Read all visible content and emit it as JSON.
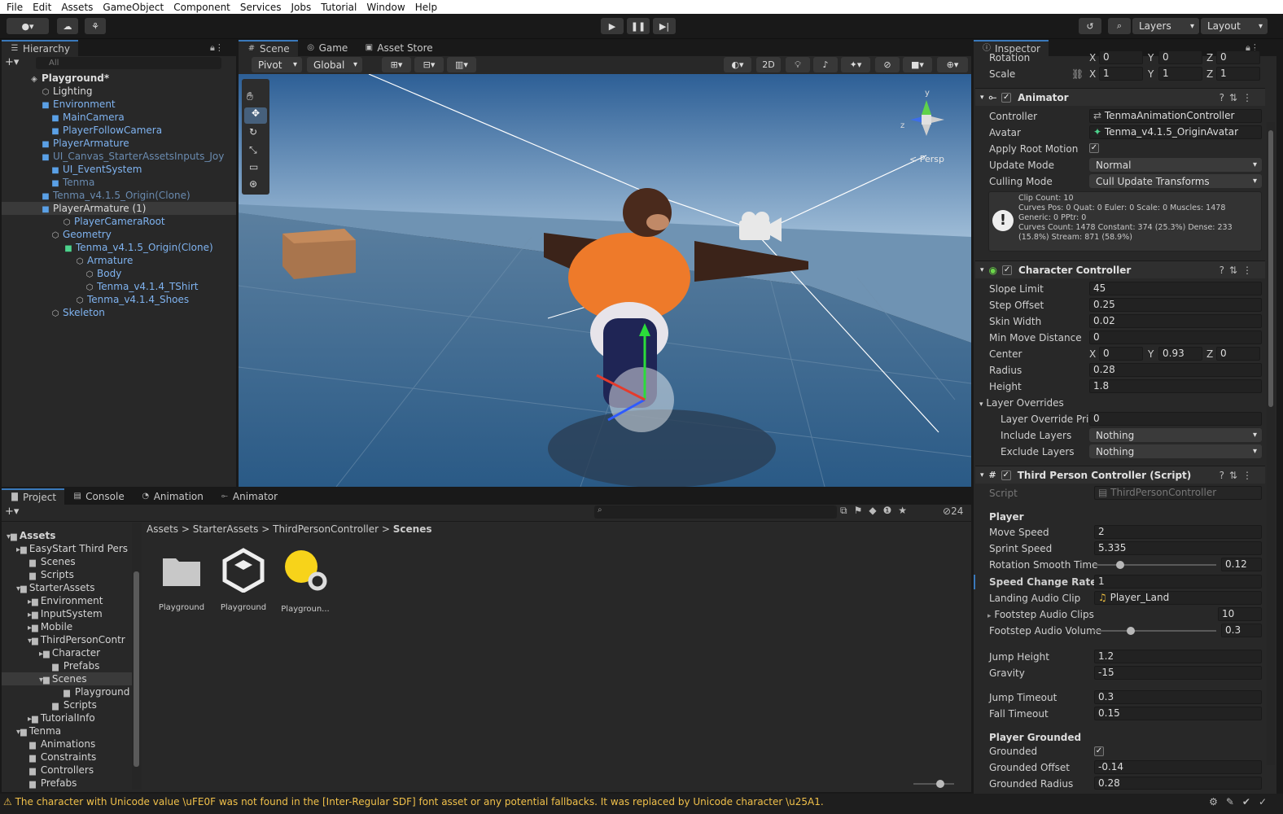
{
  "menu": [
    "File",
    "Edit",
    "Assets",
    "GameObject",
    "Component",
    "Services",
    "Jobs",
    "Tutorial",
    "Window",
    "Help"
  ],
  "toolbar": {
    "layers_label": "Layers",
    "layout_label": "Layout"
  },
  "hierarchy": {
    "tab": "Hierarchy",
    "search_placeholder": "All",
    "items": [
      {
        "label": "Playground*"
      },
      {
        "label": "Lighting"
      },
      {
        "label": "Environment"
      },
      {
        "label": "MainCamera"
      },
      {
        "label": "PlayerFollowCamera"
      },
      {
        "label": "PlayerArmature"
      },
      {
        "label": "UI_Canvas_StarterAssetsInputs_Joy"
      },
      {
        "label": "UI_EventSystem"
      },
      {
        "label": "Tenma"
      },
      {
        "label": "Tenma_v4.1.5_Origin(Clone)"
      },
      {
        "label": "PlayerArmature (1)"
      },
      {
        "label": "PlayerCameraRoot"
      },
      {
        "label": "Geometry"
      },
      {
        "label": "Tenma_v4.1.5_Origin(Clone)"
      },
      {
        "label": "Armature"
      },
      {
        "label": "Body"
      },
      {
        "label": "Tenma_v4.1.4_TShirt"
      },
      {
        "label": "Tenma_v4.1.4_Shoes"
      },
      {
        "label": "Skeleton"
      }
    ]
  },
  "scene": {
    "tabs": [
      "Scene",
      "Game",
      "Asset Store"
    ],
    "pivot": "Pivot",
    "global": "Global",
    "mode2d": "2D",
    "persp": "< Persp",
    "gizmo_y": "y",
    "gizmo_z": "z"
  },
  "project": {
    "tabs": [
      "Project",
      "Console",
      "Animation",
      "Animator"
    ],
    "hidden_count": "24",
    "breadcrumb": [
      "Assets",
      "StarterAssets",
      "ThirdPersonController",
      "Scenes"
    ],
    "tree": [
      {
        "label": "Assets"
      },
      {
        "label": "EasyStart Third Pers"
      },
      {
        "label": "Scenes"
      },
      {
        "label": "Scripts"
      },
      {
        "label": "StarterAssets"
      },
      {
        "label": "Environment"
      },
      {
        "label": "InputSystem"
      },
      {
        "label": "Mobile"
      },
      {
        "label": "ThirdPersonContr"
      },
      {
        "label": "Character"
      },
      {
        "label": "Prefabs"
      },
      {
        "label": "Scenes"
      },
      {
        "label": "Playground"
      },
      {
        "label": "Scripts"
      },
      {
        "label": "TutorialInfo"
      },
      {
        "label": "Tenma"
      },
      {
        "label": "Animations"
      },
      {
        "label": "Constraints"
      },
      {
        "label": "Controllers"
      },
      {
        "label": "Prefabs"
      }
    ],
    "assets": [
      {
        "label": "Playground"
      },
      {
        "label": "Playground"
      },
      {
        "label": "Playgroun..."
      }
    ]
  },
  "inspector": {
    "tab": "Inspector",
    "rotation": {
      "label": "Rotation",
      "x": "0",
      "y": "0",
      "z": "0"
    },
    "scale": {
      "label": "Scale",
      "x": "1",
      "y": "1",
      "z": "1"
    },
    "animator": {
      "title": "Animator",
      "controller_label": "Controller",
      "controller": "TenmaAnimationController",
      "avatar_label": "Avatar",
      "avatar": "Tenma_v4.1.5_OriginAvatar",
      "root_motion_label": "Apply Root Motion",
      "update_mode_label": "Update Mode",
      "update_mode": "Normal",
      "culling_label": "Culling Mode",
      "culling": "Cull Update Transforms",
      "info": [
        "Clip Count: 10",
        "Curves Pos: 0 Quat: 0 Euler: 0 Scale: 0 Muscles: 1478",
        "Generic: 0 PPtr: 0",
        "Curves Count: 1478 Constant: 374 (25.3%) Dense: 233",
        "(15.8%) Stream: 871 (58.9%)"
      ]
    },
    "cc": {
      "title": "Character Controller",
      "slope_label": "Slope Limit",
      "slope": "45",
      "step_label": "Step Offset",
      "step": "0.25",
      "skin_label": "Skin Width",
      "skin": "0.02",
      "minmove_label": "Min Move Distance",
      "minmove": "0",
      "center_label": "Center",
      "cx": "0",
      "cy": "0.93",
      "cz": "0",
      "radius_label": "Radius",
      "radius": "0.28",
      "height_label": "Height",
      "height": "1.8",
      "layer_ov_label": "Layer Overrides",
      "prio_label": "Layer Override Pric",
      "prio": "0",
      "include_label": "Include Layers",
      "include": "Nothing",
      "exclude_label": "Exclude Layers",
      "exclude": "Nothing"
    },
    "tpc": {
      "title": "Third Person Controller (Script)",
      "script_label": "Script",
      "script": "ThirdPersonController",
      "player_header": "Player",
      "move_label": "Move Speed",
      "move": "2",
      "sprint_label": "Sprint Speed",
      "sprint": "5.335",
      "rot_label": "Rotation Smooth Time",
      "rot": "0.12",
      "rot_frac": 0.21,
      "speed_change_label": "Speed Change Rate",
      "speed_change": "1",
      "landing_label": "Landing Audio Clip",
      "landing": "Player_Land",
      "footstep_label": "Footstep Audio Clips",
      "footstep": "10",
      "fvol_label": "Footstep Audio Volume",
      "fvol": "0.3",
      "fvol_frac": 0.3,
      "jump_label": "Jump Height",
      "jump": "1.2",
      "gravity_label": "Gravity",
      "gravity": "-15",
      "jt_label": "Jump Timeout",
      "jt": "0.3",
      "ft_label": "Fall Timeout",
      "ft": "0.15",
      "grounded_header": "Player Grounded",
      "grounded_label": "Grounded",
      "go_label": "Grounded Offset",
      "go": "-0.14",
      "gr_label": "Grounded Radius",
      "gr": "0.28"
    }
  },
  "status": "The character with Unicode value \\uFE0F was not found in the [Inter-Regular SDF] font asset or any potential fallbacks. It was replaced by Unicode character \\u25A1."
}
